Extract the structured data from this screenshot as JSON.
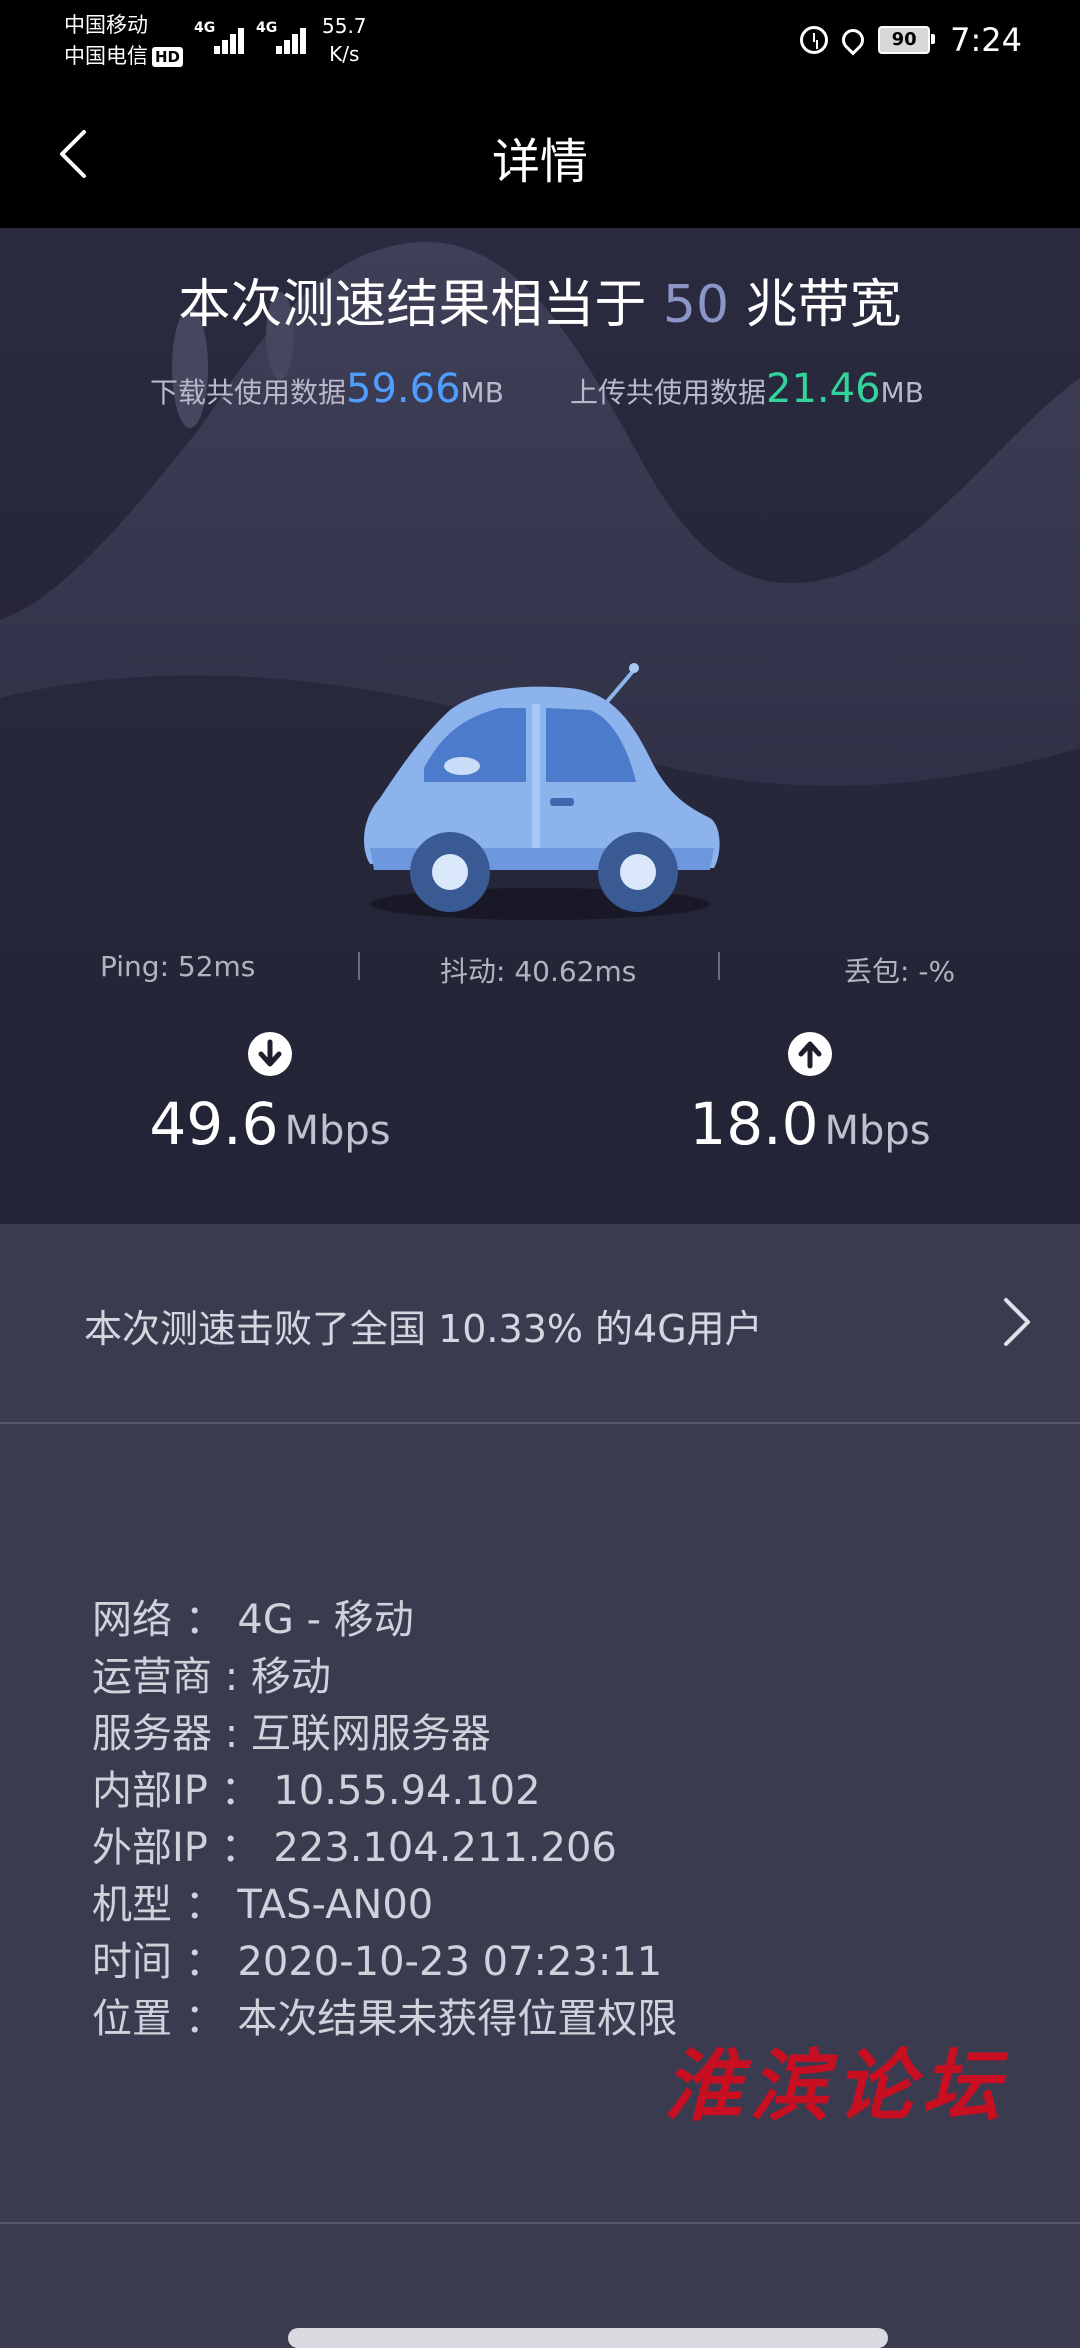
{
  "status_bar": {
    "carrier1": "中国移动",
    "carrier2": "中国电信",
    "hd_badge": "HD",
    "sig1_label": "4G",
    "sig2_label": "4G",
    "net_speed_value": "55.7",
    "net_speed_unit": "K/s",
    "battery": "90",
    "time": "7:24"
  },
  "nav": {
    "title": "详情"
  },
  "result": {
    "headline_prefix": "本次测速结果相当于",
    "bandwidth": "50",
    "headline_suffix": "兆带宽",
    "download_label": "下载共使用数据",
    "download_value": "59.66",
    "download_unit": "MB",
    "upload_label": "上传共使用数据",
    "upload_value": "21.46",
    "upload_unit": "MB"
  },
  "speeds": {
    "download_value": "49.6",
    "download_unit": "Mbps",
    "upload_value": "18.0",
    "upload_unit": "Mbps"
  },
  "metrics": {
    "ping": "Ping:  52ms",
    "jitter": "抖动:  40.62ms",
    "loss": "丢包:  -%"
  },
  "rank": {
    "text": "本次测速击败了全国 10.33% 的4G用户"
  },
  "details": [
    "网络 ： 4G - 移动",
    "运营商 : 移动",
    "服务器 : 互联网服务器",
    "内部IP ： 10.55.94.102",
    "外部IP ： 223.104.211.206",
    "机型 ： TAS-AN00",
    "时间 ： 2020-10-23 07:23:11",
    "位置 ： 本次结果未获得位置权限"
  ],
  "watermark": "淮滨论坛",
  "colors": {
    "download_accent": "#4f9eff",
    "upload_accent": "#33d39b",
    "bandwidth_accent": "#8b95c8",
    "watermark": "#c80f22"
  }
}
